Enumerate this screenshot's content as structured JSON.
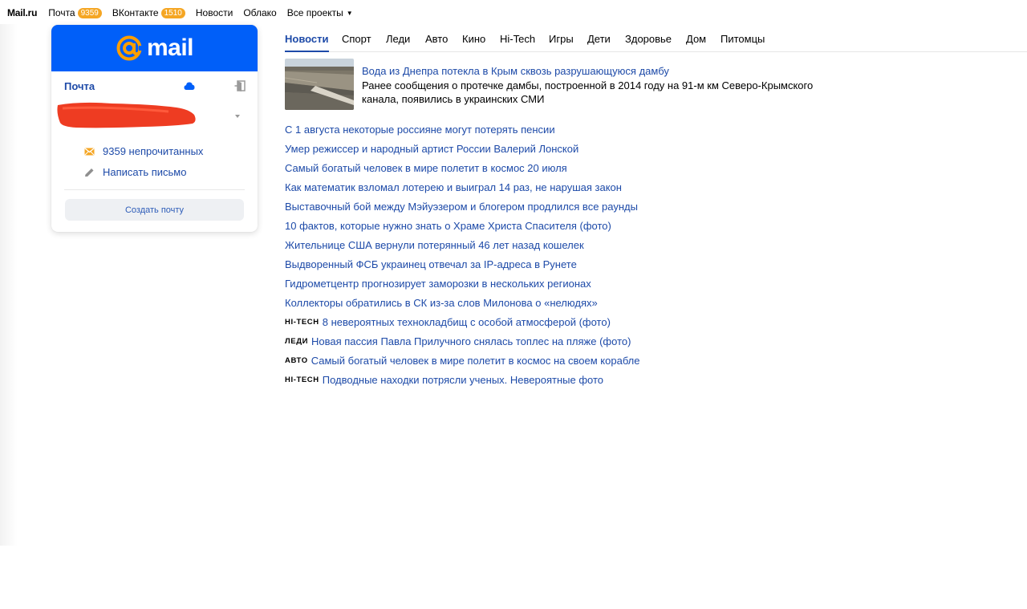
{
  "colors": {
    "brand": "#005ff9",
    "link": "#1d4aa8",
    "badge": "#f5a623",
    "redaction": "#ee3c22"
  },
  "topnav": {
    "brand": "Mail.ru",
    "items": [
      {
        "label": "Почта",
        "badge": "9359"
      },
      {
        "label": "ВКонтакте",
        "badge": "1510"
      },
      {
        "label": "Новости"
      },
      {
        "label": "Облако"
      },
      {
        "label": "Все проекты",
        "icon": "caret-down-icon"
      }
    ]
  },
  "mail_card": {
    "logo_text": "mail",
    "title": "Почта",
    "icons": [
      "cloud-icon",
      "exit-icon",
      "envelope-icon",
      "pencil-icon"
    ],
    "account_redacted": true,
    "unread_label": "9359 непрочитанных",
    "compose_label": "Написать письмо",
    "create_button": "Создать почту"
  },
  "tabs": [
    {
      "label": "Новости",
      "active": true
    },
    {
      "label": "Спорт"
    },
    {
      "label": "Леди"
    },
    {
      "label": "Авто"
    },
    {
      "label": "Кино"
    },
    {
      "label": "Hi-Tech"
    },
    {
      "label": "Игры"
    },
    {
      "label": "Дети"
    },
    {
      "label": "Здоровье"
    },
    {
      "label": "Дом"
    },
    {
      "label": "Питомцы"
    }
  ],
  "featured": {
    "title": "Вода из Днепра потекла в Крым сквозь разрушающуюся дамбу",
    "description": "Ранее сообщения о протечке дамбы, построенной в 2014 году на 91-м км Северо-Крымского канала, появились в украинских СМИ"
  },
  "news": [
    {
      "title": "С 1 августа некоторые россияне могут потерять пенсии"
    },
    {
      "title": "Умер режиссер и народный артист России Валерий Лонской"
    },
    {
      "title": "Самый богатый человек в мире полетит в космос 20 июля"
    },
    {
      "title": "Как математик взломал лотерею и выиграл 14 раз, не нарушая закон"
    },
    {
      "title": "Выставочный бой между Мэйуэзером и блогером продлился все раунды"
    },
    {
      "title": "10 фактов, которые нужно знать о Храме Христа Спасителя (фото)"
    },
    {
      "title": "Жительнице США вернули потерянный 46 лет назад кошелек"
    },
    {
      "title": "Выдворенный ФСБ украинец отвечал за IP-адреса в Рунете"
    },
    {
      "title": "Гидрометцентр прогнозирует заморозки в нескольких регионах"
    },
    {
      "title": "Коллекторы обратились в СК из-за слов Милонова о «нелюдях»"
    },
    {
      "category": "HI-TECH",
      "title": "8 невероятных технокладбищ с особой атмосферой (фото)"
    },
    {
      "category": "ЛЕДИ",
      "title": "Новая пассия Павла Прилучного снялась топлес на пляже (фото)"
    },
    {
      "category": "АВТО",
      "title": "Самый богатый человек в мире полетит в космос на своем корабле"
    },
    {
      "category": "HI-TECH",
      "title": "Подводные находки потрясли ученых. Невероятные фото"
    }
  ]
}
